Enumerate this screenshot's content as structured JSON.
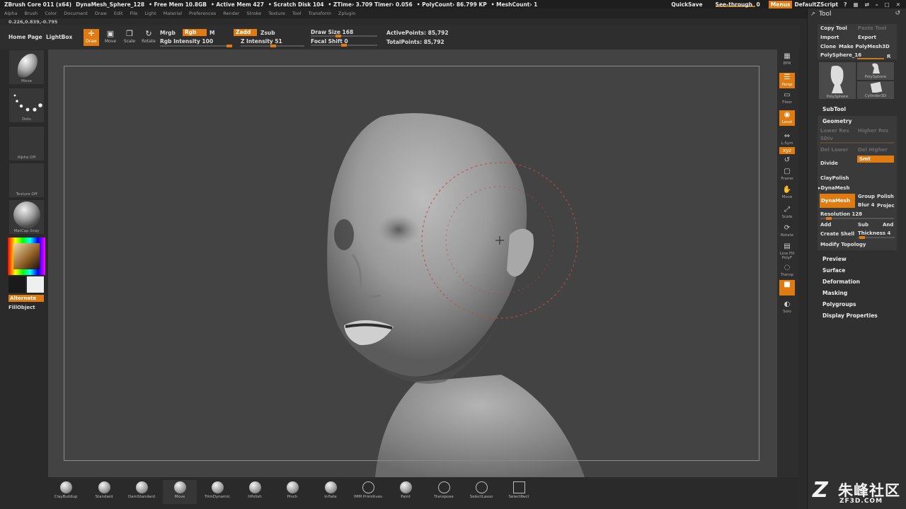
{
  "titlebar": {
    "app": "ZBrush Core 011 (x64)",
    "document": "DynaMesh_Sphere_128",
    "free_mem": "• Free Mem 10.8GB",
    "active_mem": "• Active Mem 427",
    "scratch_disk": "• Scratch Disk 104",
    "ztime": "• ZTime› 3.709 Timer› 0.056",
    "polycount": "• PolyCount› 86.799 KP",
    "meshcount": "• MeshCount› 1",
    "quicksave": "QuickSave",
    "see_through_label": "See-through",
    "see_through_value": "0",
    "menus": "Menus",
    "script": "DefaultZScript"
  },
  "menubar": [
    "Alpha",
    "Brush",
    "Color",
    "Document",
    "Draw",
    "Edit",
    "File",
    "Light",
    "Material",
    "Preferences",
    "Render",
    "Stroke",
    "Texture",
    "Tool",
    "Transform",
    "Zplugin"
  ],
  "coords": "0.226,0.839,-0.795",
  "shelf": {
    "home_page": "Home Page",
    "lightbox": "LightBox",
    "modes": [
      {
        "glyph": "✛",
        "label": "Draw",
        "active": true
      },
      {
        "glyph": "▣",
        "label": "Move",
        "active": false
      },
      {
        "glyph": "❒",
        "label": "Scale",
        "active": false
      },
      {
        "glyph": "↻",
        "label": "Rotate",
        "active": false
      }
    ],
    "mrgb": "Mrgb",
    "rgb": "Rgb",
    "m": "M",
    "rgb_intensity": "Rgb Intensity 100",
    "zadd": "Zadd",
    "zsub": "Zsub",
    "z_intensity": "Z Intensity 51",
    "draw_size": "Draw Size 168",
    "focal_shift": "Focal Shift 0",
    "active_points": "ActivePoints: 85,792",
    "total_points": "TotalPoints: 85,792",
    "rgb_intensity_level": 1.0,
    "z_intensity_level": 0.51,
    "draw_size_level": 0.42,
    "focal_shift_level": 0.5
  },
  "left_shelf": {
    "brush": "Move",
    "stroke": "Dots",
    "alpha": "Alpha Off",
    "texture": "Texture Off",
    "material": "MatCap Gray",
    "alternate": "Alternate",
    "fill_object": "FillObject",
    "primary_color": "#1a1a1a",
    "secondary_color": "#efefef"
  },
  "right_strip": [
    {
      "glyph": "▦",
      "label": "BPR",
      "on": false
    },
    {
      "glyph": "☰",
      "label": "Persp",
      "on": true
    },
    {
      "glyph": "▭",
      "label": "Floor",
      "on": false
    },
    {
      "glyph": "◉",
      "label": "Local",
      "on": true
    },
    {
      "glyph": "⇔",
      "label": "L.Sym",
      "on": false
    },
    {
      "glyph": "xyz",
      "label": "",
      "on": true
    },
    {
      "glyph": "↺",
      "label": "",
      "on": false
    },
    {
      "glyph": "▢",
      "label": "Frame",
      "on": false
    },
    {
      "glyph": "✋",
      "label": "Move",
      "on": false
    },
    {
      "glyph": "⤢",
      "label": "Scale",
      "on": false
    },
    {
      "glyph": "⟳",
      "label": "Rotate",
      "on": false
    },
    {
      "glyph": "▤",
      "label": "Line Fill PolyF",
      "on": false
    },
    {
      "glyph": "◌",
      "label": "Transp",
      "on": false
    },
    {
      "glyph": "■",
      "label": "",
      "on": true
    },
    {
      "glyph": "◐",
      "label": "Solo",
      "on": false
    }
  ],
  "tool": {
    "title": "Tool",
    "copy_tool": "Copy Tool",
    "paste_tool": "Paste Tool",
    "import": "Import",
    "export": "Export",
    "clone": "Clone",
    "make_polymesh": "Make PolyMesh3D",
    "current": "PolySphere_16",
    "r": "R",
    "thumbs": [
      "PolySphere",
      "PolySphere",
      "Cylinder3D"
    ],
    "subtool": "SubTool",
    "geometry": "Geometry",
    "lower_res": "Lower Res",
    "higher_res": "Higher Res",
    "sdiv": "SDiv",
    "del_lower": "Del Lower",
    "del_higher": "Del Higher",
    "smt": "Smt",
    "divide": "Divide",
    "claypolish": "ClayPolish",
    "dynamesh_header": "▸DynaMesh",
    "dynamesh_btn": "DynaMesh",
    "group": "Group",
    "polish": "Polish",
    "blur": "Blur 4",
    "project": "Projec",
    "resolution": "Resolution 128",
    "add": "Add",
    "sub": "Sub",
    "and": "And",
    "create_shell": "Create Shell",
    "thickness": "Thickness 4",
    "modify_topology": "Modify Topology",
    "sections": [
      "Preview",
      "Surface",
      "Deformation",
      "Masking",
      "Polygroups",
      "Display Properties"
    ]
  },
  "bottom_brushes": [
    "ClayBuildup",
    "Standard",
    "DamStandard",
    "Move",
    "TrimDynamic",
    "hPolish",
    "Pinch",
    "Inflate",
    "IMM Primitives",
    "Paint",
    "Transpose",
    "SelectLasso",
    "SelectRect"
  ],
  "watermark": {
    "cn": "朱峰社区",
    "url": "ZF3D.COM"
  }
}
